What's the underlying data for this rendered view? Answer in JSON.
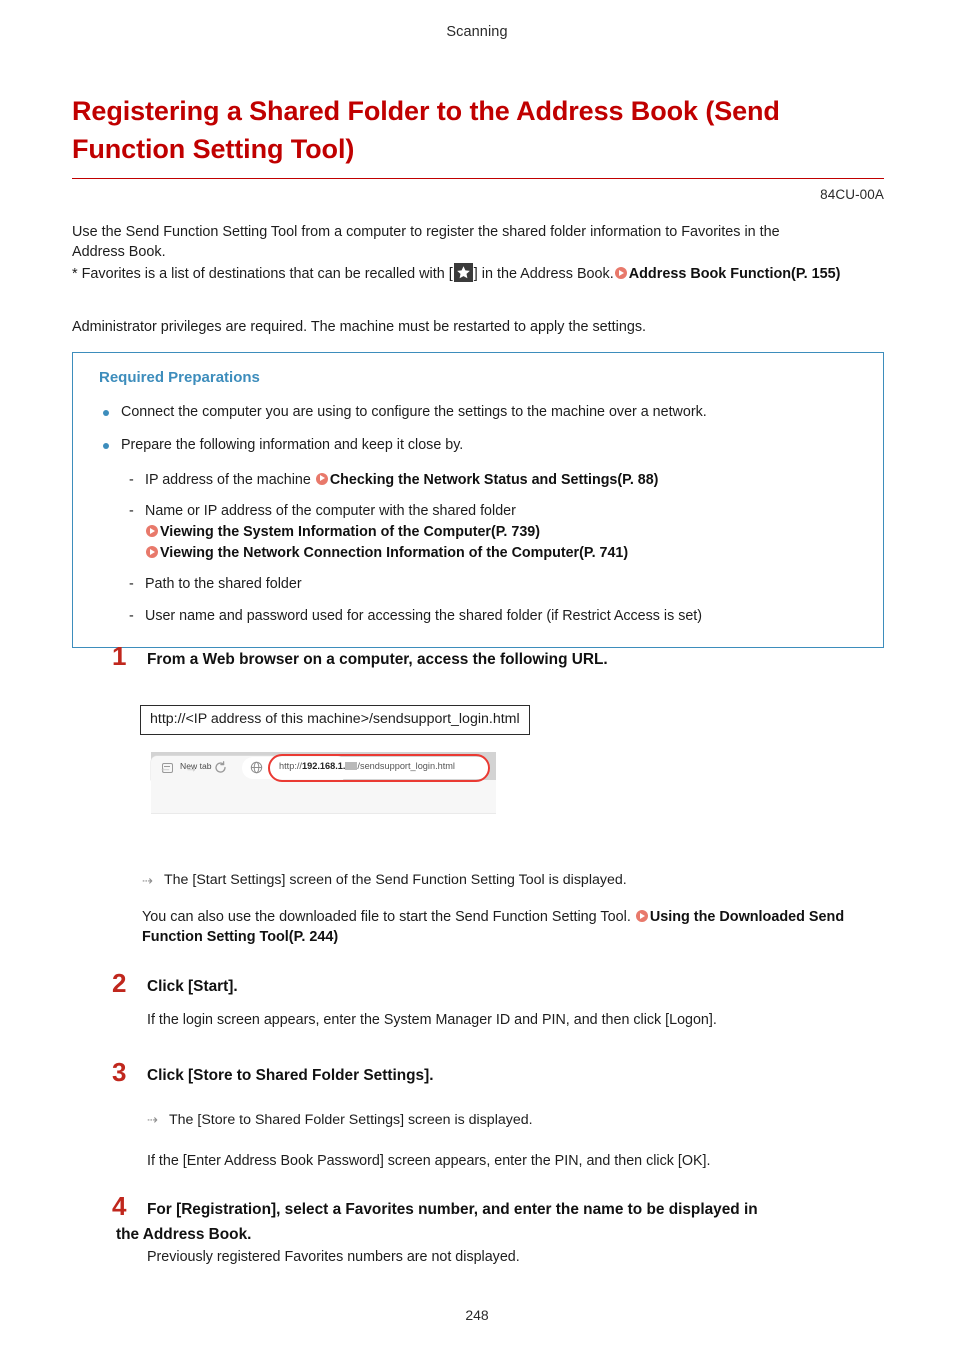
{
  "header": {
    "running_head": "Scanning"
  },
  "title": {
    "line1": "Registering a Shared Folder to the Address Book (Send",
    "line2": "Function Setting Tool)",
    "doc_code": "84CU-00A",
    "color": "#c00000"
  },
  "intro": {
    "line1": "Use the Send Function Setting Tool from a computer to register the shared folder information to Favorites in the",
    "line2": "Address Book.",
    "favorites_prefix": "* Favorites is a list of destinations that can be recalled with [",
    "favorites_suffix": "] in the Address Book.",
    "favorites_link": "Address Book Function(P. 155)",
    "admin_note": "Administrator privileges are required. The machine must be restarted to apply the settings."
  },
  "required_preparations": {
    "title": "Required Preparations",
    "border_color": "#3d8dbc",
    "bullets": [
      "Connect the computer you are using to configure the settings to the machine over a network.",
      "Prepare the following information and keep it close by."
    ],
    "sub_items": [
      {
        "text": "IP address of the machine ",
        "links": [
          "Checking the Network Status and Settings(P. 88)"
        ]
      },
      {
        "text": "Name or IP address of the computer with the shared folder",
        "links": [
          "Viewing the System Information of the Computer(P. 739)",
          "Viewing the Network Connection Information of the Computer(P. 741)"
        ]
      },
      {
        "text": "Path to the shared folder",
        "links": []
      },
      {
        "text": "User name and password used for accessing the shared folder (if Restrict Access is set)",
        "links": []
      }
    ]
  },
  "steps": [
    {
      "number": "1",
      "title": "From a Web browser on a computer, access the following URL.",
      "url_box": "http://<IP address of this machine>/sendsupport_login.html",
      "result": "The [Start Settings] screen of the Send Function Setting Tool is displayed.",
      "note_text": "You can also use the downloaded file to start the Send Function Setting Tool. ",
      "note_link": "Using the Downloaded Send Function Setting Tool(P. 244)"
    },
    {
      "number": "2",
      "title": "Click [Start].",
      "body": "If the login screen appears, enter the System Manager ID and PIN, and then click [Logon]."
    },
    {
      "number": "3",
      "title": "Click [Store to Shared Folder Settings].",
      "result": "The [Store to Shared Folder Settings] screen is displayed.",
      "body": "If the [Enter Address Book Password] screen appears, enter the PIN, and then click [OK]."
    },
    {
      "number": "4",
      "title_line1": "For [Registration], select a Favorites number, and enter the name to be displayed in",
      "title_line2": "the Address Book.",
      "body": "Previously registered Favorites numbers are not displayed."
    }
  ],
  "browser_screenshot": {
    "tab_label": "New tab",
    "close_glyph": "×",
    "newtab_glyph": "+",
    "back_glyph": "←",
    "forward_glyph": "→",
    "url_prefix": "http://",
    "url_host": "192.168.1.",
    "url_path": "/sendsupport_login.html",
    "highlight_color": "#ea3a33"
  },
  "footer": {
    "page_number": "248"
  }
}
